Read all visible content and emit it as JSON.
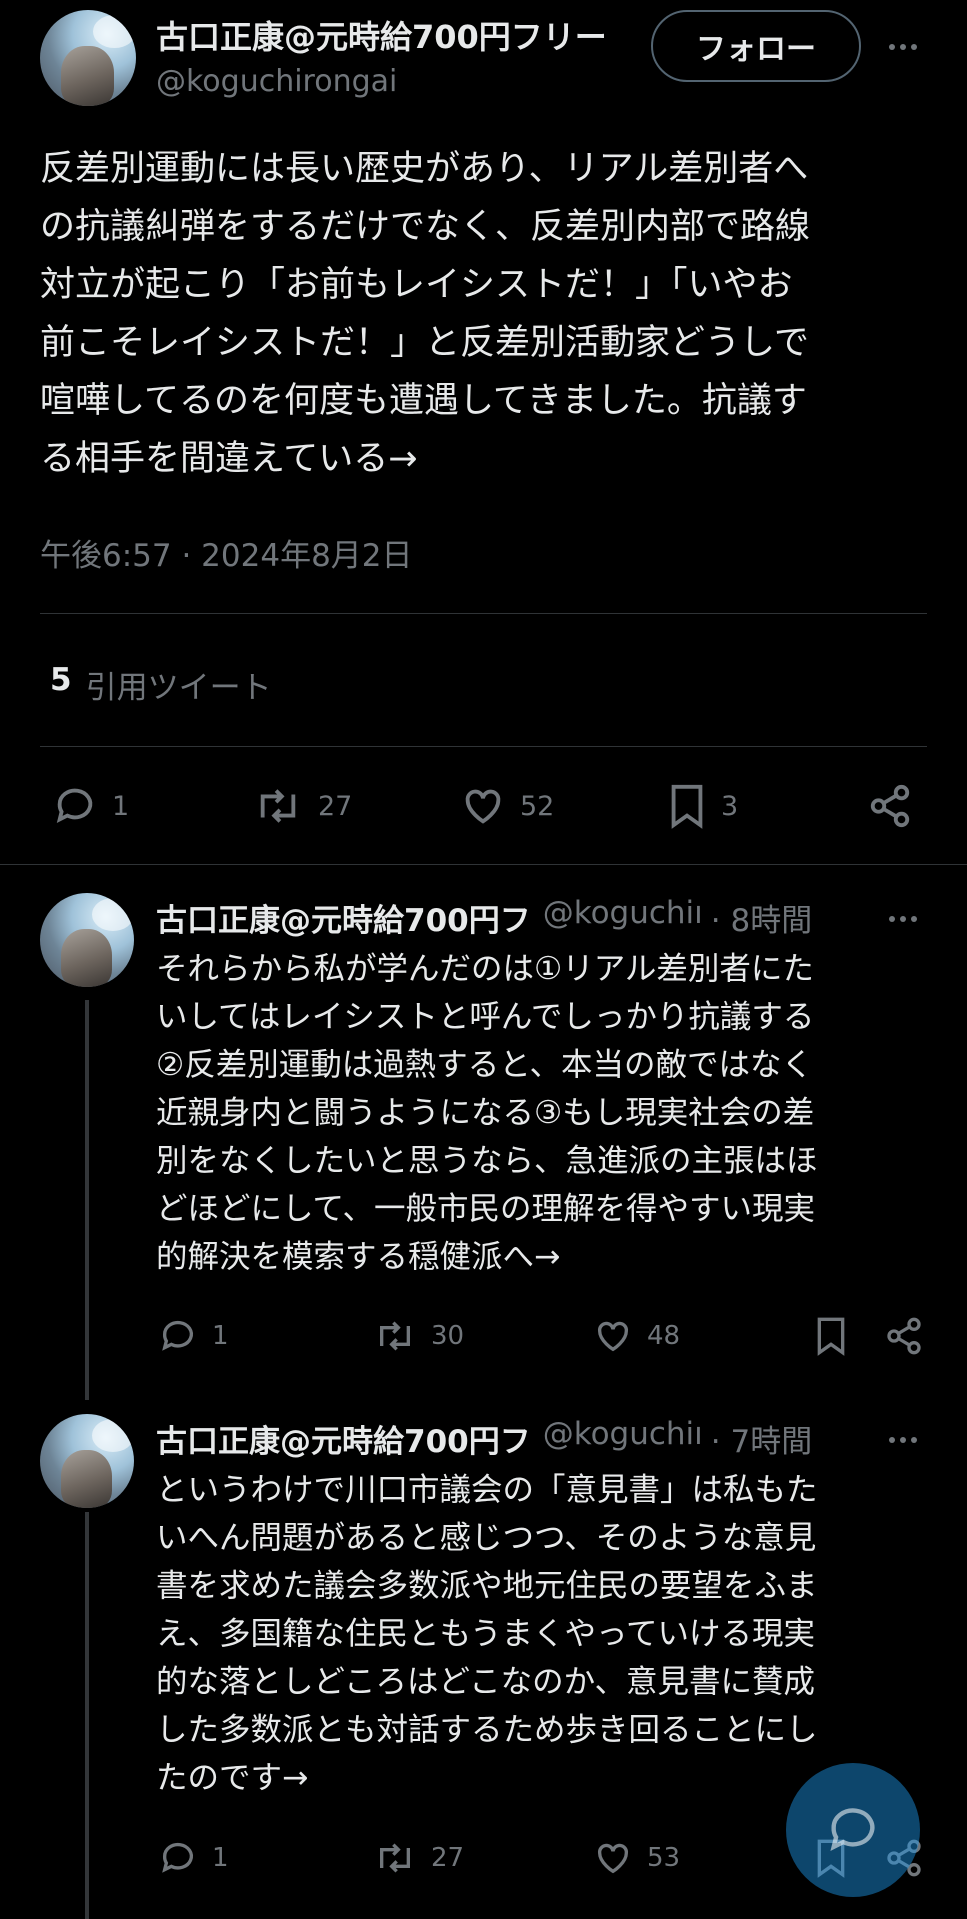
{
  "main_tweet": {
    "author_name": "古口正康@元時給700円フリー",
    "handle": "@koguchirongai",
    "follow_label": "フォロー",
    "text": "反差別運動には長い歴史があり、リアル差別者へ\nの抗議糾弾をするだけでなく、反差別内部で路線\n対立が起こり「お前もレイシストだ！」「いやお\n前こそレイシストだ！」と反差別活動家どうしで\n喧嘩してるのを何度も遭遇してきました。抗議す\nる相手を間違えている→",
    "timestamp": "午後6:57 · 2024年8月2日",
    "quote_count": "5",
    "quote_label": "引用ツイート",
    "replies": "1",
    "retweets": "27",
    "likes": "52",
    "bookmarks": "3"
  },
  "replies": [
    {
      "author_name": "古口正康@元時給700円フ",
      "handle": "@koguchiı",
      "time": "· 8時間",
      "text": "それらから私が学んだのは①リアル差別者にた\nいしてはレイシストと呼んでしっかり抗議する\n②反差別運動は過熱すると、本当の敵ではなく\n近親身内と闘うようになる③もし現実社会の差\n別をなくしたいと思うなら、急進派の主張はほ\nどほどにして、一般市民の理解を得やすい現実\n的解決を模索する穏健派へ→",
      "replies": "1",
      "retweets": "30",
      "likes": "48"
    },
    {
      "author_name": "古口正康@元時給700円フ",
      "handle": "@koguchiı",
      "time": "· 7時間",
      "text": "というわけで川口市議会の「意見書」は私もた\nいへん問題があると感じつつ、そのような意見\n書を求めた議会多数派や地元住民の要望をふま\nえ、多国籍な住民ともうまくやっていける現実\n的な落としどころはどこなのか、意見書に賛成\nした多数派とも対話するため歩き回ることにし\nたのです→",
      "replies": "1",
      "retweets": "27",
      "likes": "53"
    }
  ],
  "colors": {
    "background": "#000000",
    "text": "#e7e9ea",
    "muted": "#71767b",
    "accent": "#1d9bf0"
  },
  "icons": [
    "reply-icon",
    "retweet-icon",
    "like-icon",
    "bookmark-icon",
    "share-icon",
    "more-icon",
    "compose-icon"
  ]
}
